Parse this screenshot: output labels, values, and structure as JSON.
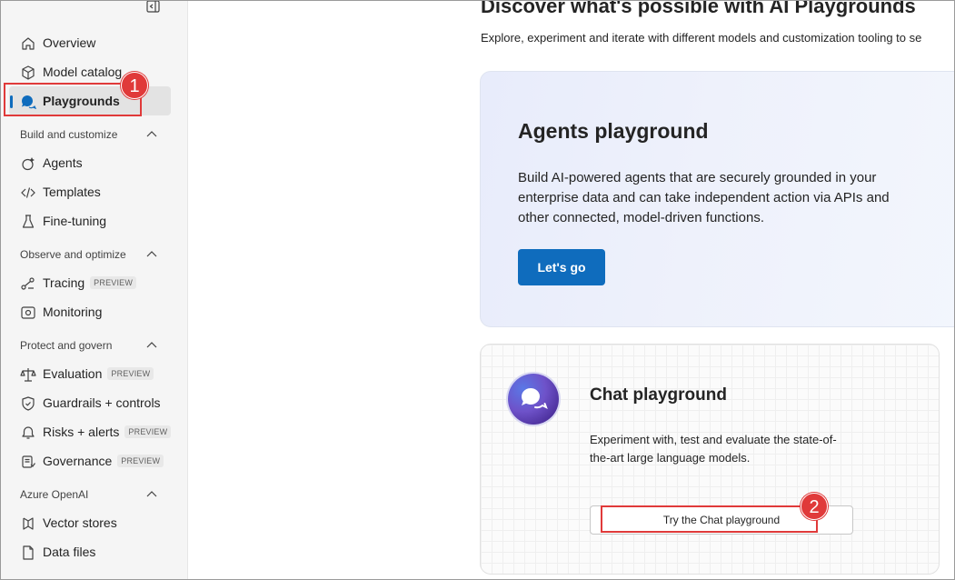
{
  "sidebar": {
    "items": [
      {
        "label": "Overview",
        "icon": "home-icon"
      },
      {
        "label": "Model catalog",
        "icon": "cube-icon"
      },
      {
        "label": "Playgrounds",
        "icon": "chat-bubbles-icon",
        "active": true
      }
    ],
    "sections": [
      {
        "label": "Build and customize",
        "items": [
          {
            "label": "Agents",
            "icon": "agent-icon"
          },
          {
            "label": "Templates",
            "icon": "code-icon"
          },
          {
            "label": "Fine-tuning",
            "icon": "flask-icon"
          }
        ]
      },
      {
        "label": "Observe and optimize",
        "items": [
          {
            "label": "Tracing",
            "icon": "trace-icon",
            "badge": "PREVIEW"
          },
          {
            "label": "Monitoring",
            "icon": "monitor-icon"
          }
        ]
      },
      {
        "label": "Protect and govern",
        "items": [
          {
            "label": "Evaluation",
            "icon": "scale-icon",
            "badge": "PREVIEW"
          },
          {
            "label": "Guardrails + controls",
            "icon": "shield-icon"
          },
          {
            "label": "Risks + alerts",
            "icon": "alert-icon",
            "badge": "PREVIEW"
          },
          {
            "label": "Governance",
            "icon": "governance-icon",
            "badge": "PREVIEW"
          }
        ]
      },
      {
        "label": "Azure OpenAI",
        "items": [
          {
            "label": "Vector stores",
            "icon": "vector-icon"
          },
          {
            "label": "Data files",
            "icon": "file-icon"
          }
        ]
      }
    ]
  },
  "main": {
    "title": "Discover what's possible with AI Playgrounds",
    "subtitle": "Explore, experiment and iterate with different models and customization tooling to se",
    "agents_card": {
      "title": "Agents playground",
      "description": "Build AI-powered agents that are securely grounded in your enterprise data and can take independent action via APIs and other connected, model-driven functions.",
      "button": "Let's go"
    },
    "chat_card": {
      "title": "Chat playground",
      "description": "Experiment with, test and evaluate the state-of-the-art large language models.",
      "button": "Try the Chat playground"
    }
  },
  "annotations": {
    "marker1": "1",
    "marker2": "2",
    "color": "#e03a3a"
  },
  "colors": {
    "accent": "#0f6cbd"
  }
}
